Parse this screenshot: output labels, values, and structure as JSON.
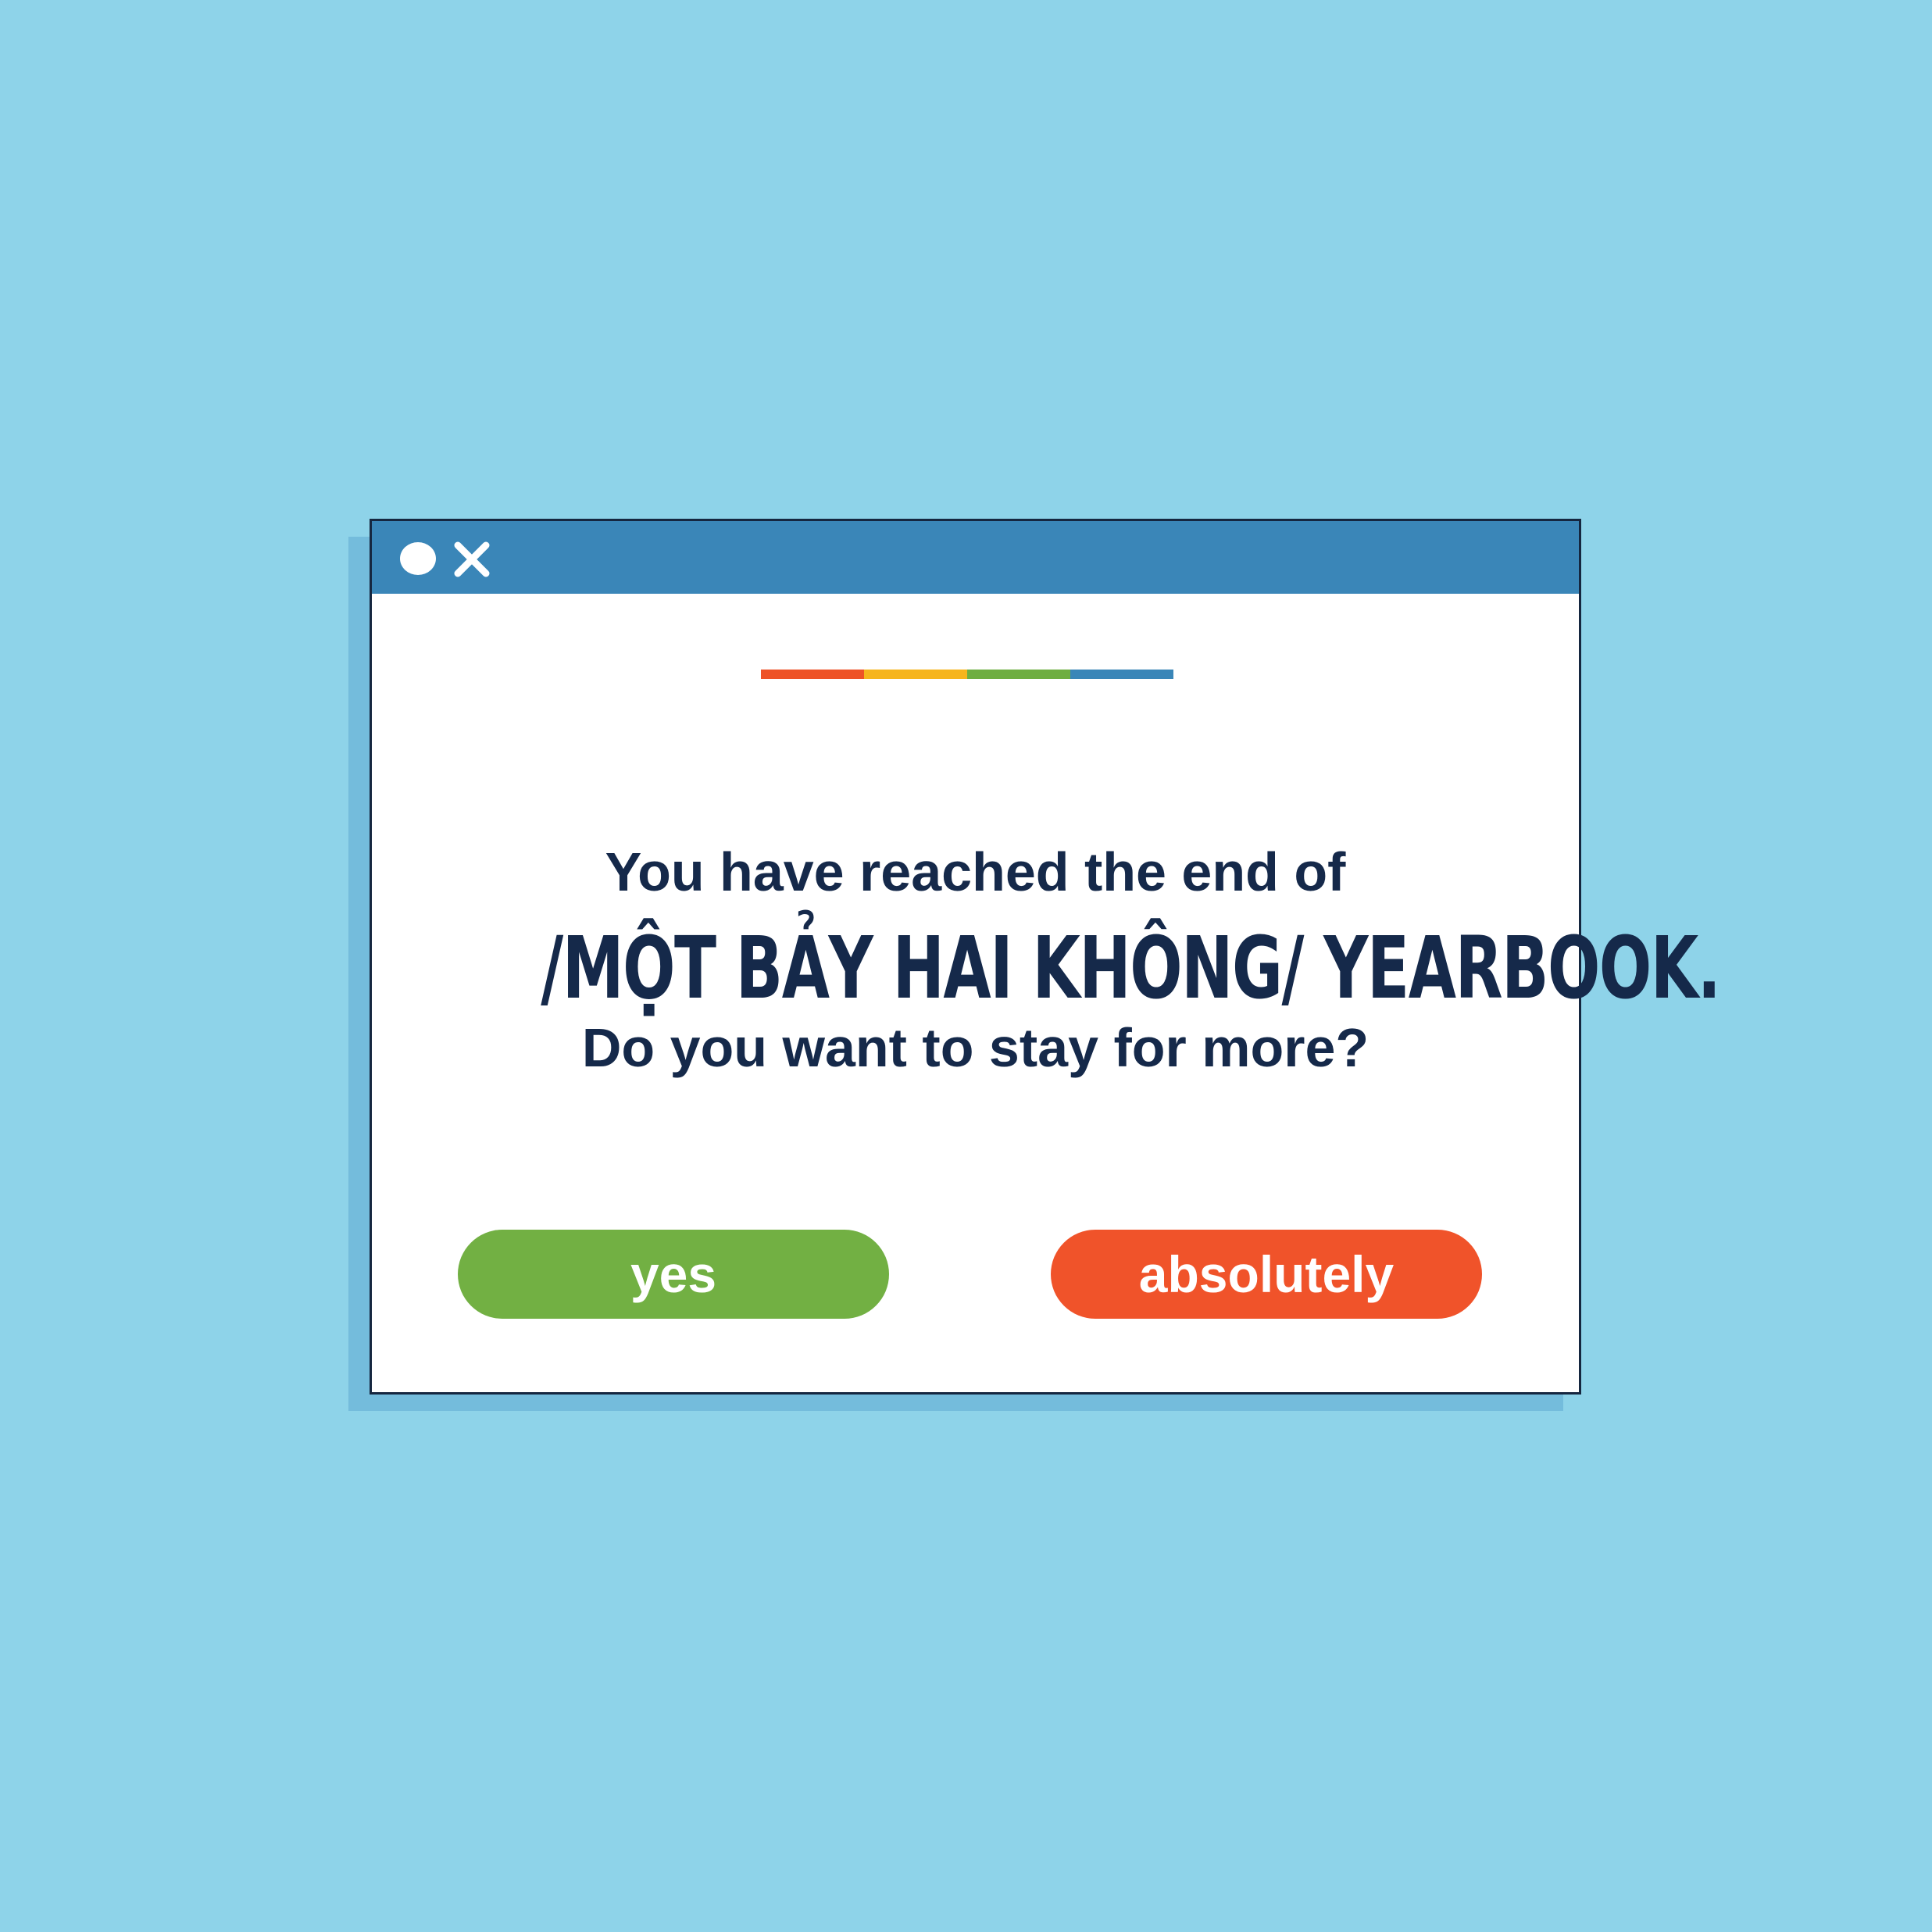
{
  "colors": {
    "background": "#8ed3e9",
    "shadow": "#74bcdc",
    "titlebar": "#3a86b8",
    "text": "#15294a",
    "yes_button": "#72b043",
    "absolutely_button": "#f0532a"
  },
  "titlebar": {
    "icons": [
      "circle-icon",
      "close-icon"
    ]
  },
  "rainbow_bar": {
    "segments": [
      "#ee5327",
      "#f6b51d",
      "#6eae41",
      "#3a86b8"
    ]
  },
  "dialog": {
    "line1": "You have reached the end of",
    "line2": "/MỘT BẢY HAI KHÔNG/ YEARBOOK.",
    "line3": "Do you want to stay for more?"
  },
  "buttons": {
    "yes_label": "yes",
    "absolutely_label": "absolutely"
  }
}
